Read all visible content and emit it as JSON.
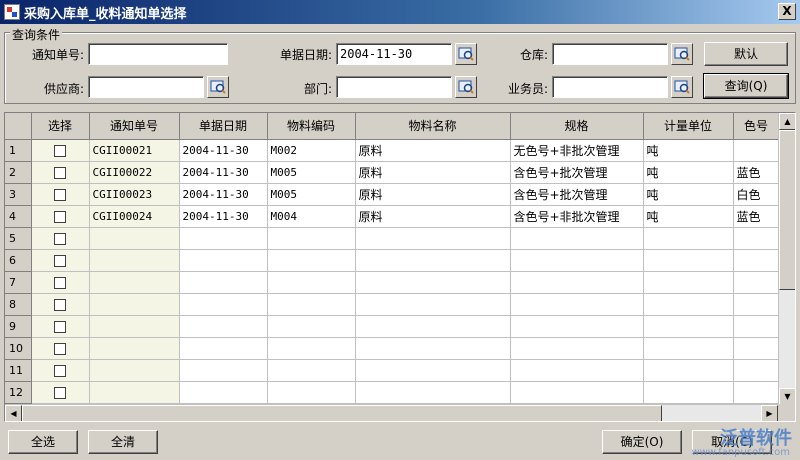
{
  "window": {
    "title": "采购入库单_收料通知单选择",
    "close": "X"
  },
  "query": {
    "legend": "查询条件",
    "notice_no_label": "通知单号:",
    "notice_no_value": "",
    "doc_date_label": "单据日期:",
    "doc_date_value": "2004-11-30",
    "warehouse_label": "仓库:",
    "warehouse_value": "",
    "supplier_label": "供应商:",
    "supplier_value": "",
    "dept_label": "部门:",
    "dept_value": "",
    "salesman_label": "业务员:",
    "salesman_value": "",
    "default_btn": "默认",
    "query_btn": "查询(Q)"
  },
  "grid": {
    "headers": [
      "选择",
      "通知单号",
      "单据日期",
      "物料编码",
      "物料名称",
      "规格",
      "计量单位",
      "色号"
    ],
    "row_numbers": [
      "1",
      "2",
      "3",
      "4",
      "5",
      "6",
      "7",
      "8",
      "9",
      "10",
      "11",
      "12"
    ],
    "rows": [
      {
        "code": "CGII00021",
        "date": "2004-11-30",
        "mat": "M002",
        "name": "原料",
        "spec": "无色号+非批次管理",
        "unit": "吨",
        "color": ""
      },
      {
        "code": "CGII00022",
        "date": "2004-11-30",
        "mat": "M005",
        "name": "原料",
        "spec": "含色号+批次管理",
        "unit": "吨",
        "color": "蓝色"
      },
      {
        "code": "CGII00023",
        "date": "2004-11-30",
        "mat": "M005",
        "name": "原料",
        "spec": "含色号+批次管理",
        "unit": "吨",
        "color": "白色"
      },
      {
        "code": "CGII00024",
        "date": "2004-11-30",
        "mat": "M004",
        "name": "原料",
        "spec": "含色号+非批次管理",
        "unit": "吨",
        "color": "蓝色"
      }
    ]
  },
  "footer": {
    "select_all": "全选",
    "clear_all": "全清",
    "ok": "确定(O)",
    "cancel": "取消(C)"
  },
  "watermark": {
    "brand": "泛普软件",
    "url": "www.fanpusoft.com"
  }
}
